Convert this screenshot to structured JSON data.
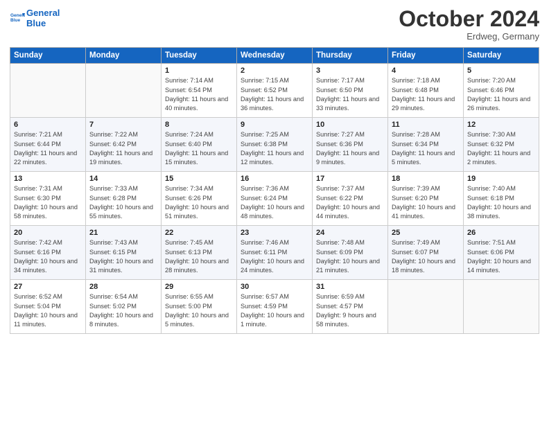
{
  "header": {
    "logo_line1": "General",
    "logo_line2": "Blue",
    "month": "October 2024",
    "location": "Erdweg, Germany"
  },
  "days_of_week": [
    "Sunday",
    "Monday",
    "Tuesday",
    "Wednesday",
    "Thursday",
    "Friday",
    "Saturday"
  ],
  "weeks": [
    [
      {
        "day": "",
        "detail": ""
      },
      {
        "day": "",
        "detail": ""
      },
      {
        "day": "1",
        "detail": "Sunrise: 7:14 AM\nSunset: 6:54 PM\nDaylight: 11 hours and 40 minutes."
      },
      {
        "day": "2",
        "detail": "Sunrise: 7:15 AM\nSunset: 6:52 PM\nDaylight: 11 hours and 36 minutes."
      },
      {
        "day": "3",
        "detail": "Sunrise: 7:17 AM\nSunset: 6:50 PM\nDaylight: 11 hours and 33 minutes."
      },
      {
        "day": "4",
        "detail": "Sunrise: 7:18 AM\nSunset: 6:48 PM\nDaylight: 11 hours and 29 minutes."
      },
      {
        "day": "5",
        "detail": "Sunrise: 7:20 AM\nSunset: 6:46 PM\nDaylight: 11 hours and 26 minutes."
      }
    ],
    [
      {
        "day": "6",
        "detail": "Sunrise: 7:21 AM\nSunset: 6:44 PM\nDaylight: 11 hours and 22 minutes."
      },
      {
        "day": "7",
        "detail": "Sunrise: 7:22 AM\nSunset: 6:42 PM\nDaylight: 11 hours and 19 minutes."
      },
      {
        "day": "8",
        "detail": "Sunrise: 7:24 AM\nSunset: 6:40 PM\nDaylight: 11 hours and 15 minutes."
      },
      {
        "day": "9",
        "detail": "Sunrise: 7:25 AM\nSunset: 6:38 PM\nDaylight: 11 hours and 12 minutes."
      },
      {
        "day": "10",
        "detail": "Sunrise: 7:27 AM\nSunset: 6:36 PM\nDaylight: 11 hours and 9 minutes."
      },
      {
        "day": "11",
        "detail": "Sunrise: 7:28 AM\nSunset: 6:34 PM\nDaylight: 11 hours and 5 minutes."
      },
      {
        "day": "12",
        "detail": "Sunrise: 7:30 AM\nSunset: 6:32 PM\nDaylight: 11 hours and 2 minutes."
      }
    ],
    [
      {
        "day": "13",
        "detail": "Sunrise: 7:31 AM\nSunset: 6:30 PM\nDaylight: 10 hours and 58 minutes."
      },
      {
        "day": "14",
        "detail": "Sunrise: 7:33 AM\nSunset: 6:28 PM\nDaylight: 10 hours and 55 minutes."
      },
      {
        "day": "15",
        "detail": "Sunrise: 7:34 AM\nSunset: 6:26 PM\nDaylight: 10 hours and 51 minutes."
      },
      {
        "day": "16",
        "detail": "Sunrise: 7:36 AM\nSunset: 6:24 PM\nDaylight: 10 hours and 48 minutes."
      },
      {
        "day": "17",
        "detail": "Sunrise: 7:37 AM\nSunset: 6:22 PM\nDaylight: 10 hours and 44 minutes."
      },
      {
        "day": "18",
        "detail": "Sunrise: 7:39 AM\nSunset: 6:20 PM\nDaylight: 10 hours and 41 minutes."
      },
      {
        "day": "19",
        "detail": "Sunrise: 7:40 AM\nSunset: 6:18 PM\nDaylight: 10 hours and 38 minutes."
      }
    ],
    [
      {
        "day": "20",
        "detail": "Sunrise: 7:42 AM\nSunset: 6:16 PM\nDaylight: 10 hours and 34 minutes."
      },
      {
        "day": "21",
        "detail": "Sunrise: 7:43 AM\nSunset: 6:15 PM\nDaylight: 10 hours and 31 minutes."
      },
      {
        "day": "22",
        "detail": "Sunrise: 7:45 AM\nSunset: 6:13 PM\nDaylight: 10 hours and 28 minutes."
      },
      {
        "day": "23",
        "detail": "Sunrise: 7:46 AM\nSunset: 6:11 PM\nDaylight: 10 hours and 24 minutes."
      },
      {
        "day": "24",
        "detail": "Sunrise: 7:48 AM\nSunset: 6:09 PM\nDaylight: 10 hours and 21 minutes."
      },
      {
        "day": "25",
        "detail": "Sunrise: 7:49 AM\nSunset: 6:07 PM\nDaylight: 10 hours and 18 minutes."
      },
      {
        "day": "26",
        "detail": "Sunrise: 7:51 AM\nSunset: 6:06 PM\nDaylight: 10 hours and 14 minutes."
      }
    ],
    [
      {
        "day": "27",
        "detail": "Sunrise: 6:52 AM\nSunset: 5:04 PM\nDaylight: 10 hours and 11 minutes."
      },
      {
        "day": "28",
        "detail": "Sunrise: 6:54 AM\nSunset: 5:02 PM\nDaylight: 10 hours and 8 minutes."
      },
      {
        "day": "29",
        "detail": "Sunrise: 6:55 AM\nSunset: 5:00 PM\nDaylight: 10 hours and 5 minutes."
      },
      {
        "day": "30",
        "detail": "Sunrise: 6:57 AM\nSunset: 4:59 PM\nDaylight: 10 hours and 1 minute."
      },
      {
        "day": "31",
        "detail": "Sunrise: 6:59 AM\nSunset: 4:57 PM\nDaylight: 9 hours and 58 minutes."
      },
      {
        "day": "",
        "detail": ""
      },
      {
        "day": "",
        "detail": ""
      }
    ]
  ]
}
